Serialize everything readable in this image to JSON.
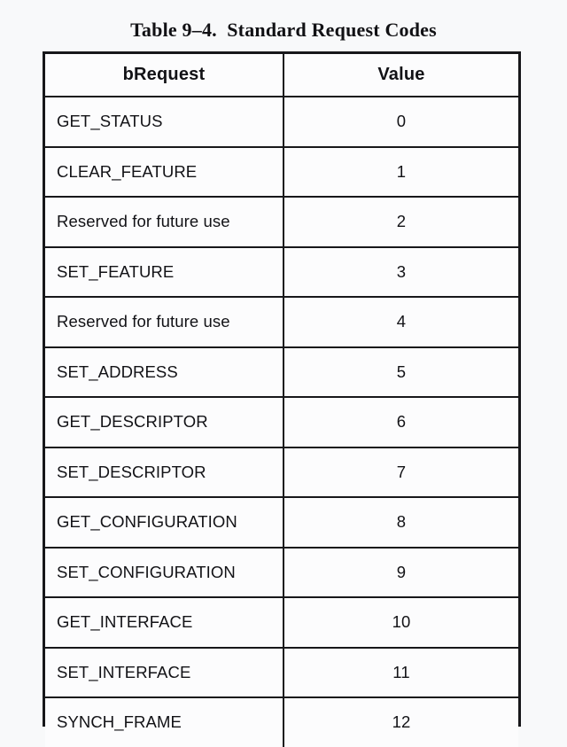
{
  "caption": "Table 9–4.  Standard Request Codes",
  "table": {
    "columns": [
      {
        "key": "bRequest",
        "label": "bRequest",
        "align": "left"
      },
      {
        "key": "value",
        "label": "Value",
        "align": "center"
      }
    ],
    "rows": [
      {
        "bRequest": "GET_STATUS",
        "value": "0"
      },
      {
        "bRequest": "CLEAR_FEATURE",
        "value": "1"
      },
      {
        "bRequest": "Reserved for future use",
        "value": "2"
      },
      {
        "bRequest": "SET_FEATURE",
        "value": "3"
      },
      {
        "bRequest": "Reserved for future use",
        "value": "4"
      },
      {
        "bRequest": "SET_ADDRESS",
        "value": "5"
      },
      {
        "bRequest": "GET_DESCRIPTOR",
        "value": "6"
      },
      {
        "bRequest": "SET_DESCRIPTOR",
        "value": "7"
      },
      {
        "bRequest": "GET_CONFIGURATION",
        "value": "8"
      },
      {
        "bRequest": "SET_CONFIGURATION",
        "value": "9"
      },
      {
        "bRequest": "GET_INTERFACE",
        "value": "10"
      },
      {
        "bRequest": "SET_INTERFACE",
        "value": "11"
      },
      {
        "bRequest": "SYNCH_FRAME",
        "value": "12"
      }
    ]
  },
  "colors": {
    "page_background": "#f8f9fa",
    "cell_background": "#fcfcfd",
    "rule": "#17171a",
    "text": "#121216"
  }
}
